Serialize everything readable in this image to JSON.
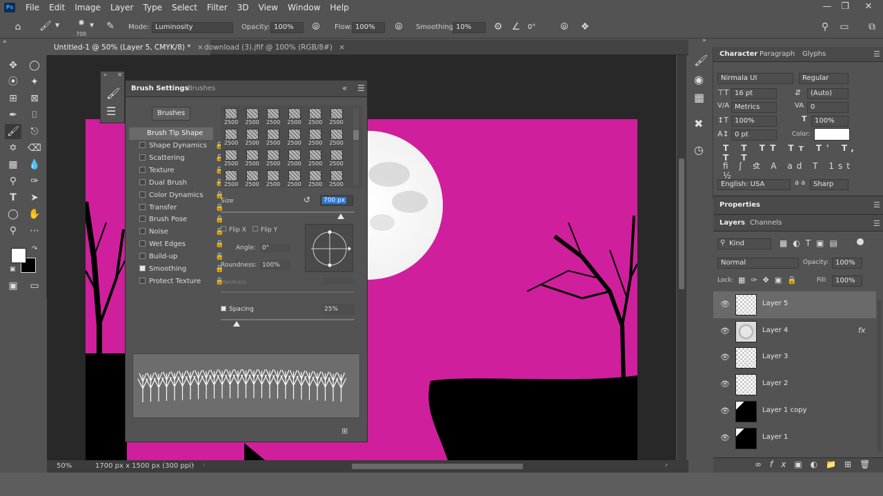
{
  "app": {
    "logo": "Ps"
  },
  "menu": [
    "File",
    "Edit",
    "Image",
    "Layer",
    "Type",
    "Select",
    "Filter",
    "3D",
    "View",
    "Window",
    "Help"
  ],
  "options": {
    "brush_size": "700",
    "mode_label": "Mode:",
    "mode_value": "Luminosity",
    "opacity_label": "Opacity:",
    "opacity_value": "100%",
    "flow_label": "Flow:",
    "flow_value": "100%",
    "smoothing_label": "Smoothing:",
    "smoothing_value": "10%",
    "angle_value": "0°"
  },
  "doc_tabs": [
    {
      "label": "Untitled-1 @ 50% (Layer 5, CMYK/8) *",
      "active": true
    },
    {
      "label": "download (3).jfif @ 100% (RGB/8#)",
      "active": false
    }
  ],
  "brush_panel": {
    "tab_settings": "Brush Settings",
    "tab_brushes": "Brushes",
    "brushes_button": "Brushes",
    "tip_shape": "Brush Tip Shape",
    "items": [
      {
        "label": "Shape Dynamics",
        "checked": false
      },
      {
        "label": "Scattering",
        "checked": false
      },
      {
        "label": "Texture",
        "checked": false
      },
      {
        "label": "Dual Brush",
        "checked": false
      },
      {
        "label": "Color Dynamics",
        "checked": false
      },
      {
        "label": "Transfer",
        "checked": false
      },
      {
        "label": "Brush Pose",
        "checked": false
      },
      {
        "label": "Noise",
        "checked": false
      },
      {
        "label": "Wet Edges",
        "checked": false
      },
      {
        "label": "Build-up",
        "checked": false
      },
      {
        "label": "Smoothing",
        "checked": true
      },
      {
        "label": "Protect Texture",
        "checked": false
      }
    ],
    "tip_sizes": [
      "2500",
      "2500",
      "2500",
      "2500",
      "2500",
      "2500",
      "2500",
      "2500",
      "2500",
      "2500",
      "2500",
      "2500",
      "2500",
      "2500",
      "2500",
      "2500",
      "2500",
      "2500",
      "2500",
      "2500",
      "2500",
      "2500",
      "2500",
      "2500"
    ],
    "size_label": "Size",
    "size_value": "700 px",
    "flip_x": "Flip X",
    "flip_y": "Flip Y",
    "angle_label": "Angle:",
    "angle_value": "0°",
    "roundness_label": "Roundness:",
    "roundness_value": "100%",
    "hardness_label": "Hardness",
    "spacing_label": "Spacing",
    "spacing_value": "25%",
    "spacing_checked": true,
    "spacing_fraction": 0.12
  },
  "character": {
    "tab_character": "Character",
    "tab_paragraph": "Paragraph",
    "tab_glyphs": "Glyphs",
    "font_family": "Nirmala UI",
    "font_style": "Regular",
    "font_size": "16 pt",
    "leading": "(Auto)",
    "kerning": "Metrics",
    "tracking": "0",
    "vscale": "100%",
    "hscale": "100%",
    "baseline": "0 pt",
    "color_label": "Color:",
    "language": "English: USA",
    "antialias": "Sharp",
    "color": "#ffffff"
  },
  "properties": {
    "title": "Properties"
  },
  "layers": {
    "tab_layers": "Layers",
    "tab_channels": "Channels",
    "filter": "Kind",
    "blend_mode": "Normal",
    "opacity_label": "Opacity:",
    "opacity_value": "100%",
    "lock_label": "Lock:",
    "fill_label": "Fill:",
    "fill_value": "100%",
    "list": [
      {
        "name": "Layer 5",
        "selected": true,
        "fx": false
      },
      {
        "name": "Layer 4",
        "selected": false,
        "fx": true
      },
      {
        "name": "Layer 3",
        "selected": false,
        "fx": false
      },
      {
        "name": "Layer 2",
        "selected": false,
        "fx": false
      },
      {
        "name": "Layer 1 copy",
        "selected": false,
        "fx": false
      },
      {
        "name": "Layer 1",
        "selected": false,
        "fx": false
      }
    ],
    "fx_symbol": "fx"
  },
  "status": {
    "zoom": "50%",
    "doc_size": "1700 px x 1500 px (300 ppi)"
  },
  "colors": {
    "canvas_magenta": "#cf1f9c",
    "accent_blue": "#2c7ad6"
  }
}
